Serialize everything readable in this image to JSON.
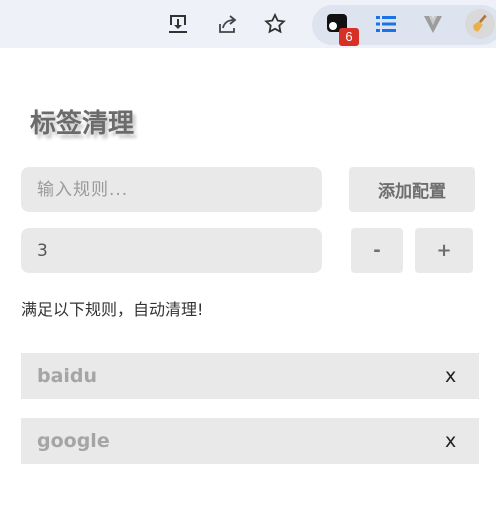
{
  "browser_toolbar": {
    "icons": [
      "install-icon",
      "share-icon",
      "bookmark-star-icon",
      "tab-cleaner-extension-icon",
      "reading-list-icon",
      "vivaldi-v-icon",
      "broom-icon"
    ],
    "extension_badge": "6",
    "accent_color": "#1a73e8",
    "badge_color": "#d93025"
  },
  "popup": {
    "title": "标签清理",
    "rule_input": {
      "value": "",
      "placeholder": "输入规则..."
    },
    "add_button_label": "添加配置",
    "count_input": {
      "value": "3"
    },
    "decrement_label": "-",
    "increment_label": "+",
    "hint": "满足以下规则，自动清理!",
    "rules": [
      {
        "name": "baidu",
        "remove_label": "x"
      },
      {
        "name": "google",
        "remove_label": "x"
      }
    ]
  }
}
